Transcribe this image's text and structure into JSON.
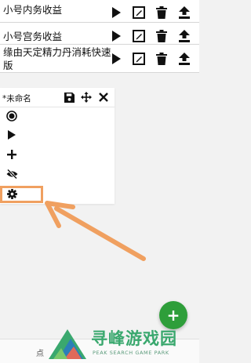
{
  "scripts": [
    {
      "name": "小号内务收益"
    },
    {
      "name": "小号宫务收益"
    },
    {
      "name": "缘由天定精力丹消耗快速版"
    }
  ],
  "row_actions": [
    "play-icon",
    "edit-icon",
    "trash-icon",
    "upload-icon"
  ],
  "panel": {
    "title": "*未命名",
    "header_icons": [
      "save-icon",
      "move-icon",
      "close-icon"
    ],
    "tools": [
      "record-icon",
      "play-icon",
      "add-icon",
      "eye-off-icon",
      "gear-icon"
    ]
  },
  "fab": {
    "label": "+"
  },
  "bottom_bar": {
    "text": "点"
  },
  "watermark": {
    "text": "寻峰游戏园",
    "sub": "PEAK SEARCH GAME PARK"
  },
  "colors": {
    "highlight": "#f0a060",
    "fab": "#2e9e3a",
    "watermark": "#3aa86e"
  }
}
